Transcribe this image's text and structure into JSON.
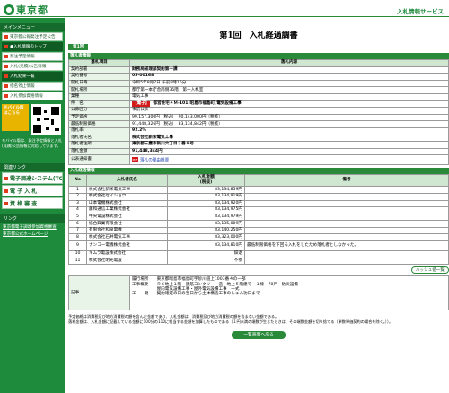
{
  "header": {
    "logo_text": "東京都",
    "service_name": "入札情報サービス"
  },
  "sidebar": {
    "menu_heading": "メインメニュー",
    "items": [
      {
        "label": "東京都公報発注予定公告"
      },
      {
        "label": "●入札情報のトップ"
      },
      {
        "label": "発注予定情報"
      },
      {
        "label": "入札(見積)公告情報"
      },
      {
        "label": "入札結果一覧"
      },
      {
        "label": "指名停止情報"
      },
      {
        "label": "入札参加資格情報"
      }
    ],
    "mobile_label": "モバイル版 はこちら",
    "mobile_note": "モバイル版は、発注予定情報と入札(見積)公告情報に対応しています。",
    "links_heading": "関連リンク",
    "big_items": [
      {
        "label": "電子調達システム(TOP)"
      },
      {
        "label": "電 子 入 札"
      },
      {
        "label": "資 格 審 査"
      }
    ],
    "links2_heading": "リンク",
    "links": [
      {
        "label": "東京都電子調達参加資格審査"
      },
      {
        "label": "東京都公式ホームページ"
      }
    ]
  },
  "main": {
    "page_title": "第1回　入札経過調書",
    "round_tag": "第1回",
    "section1_title": "落札者情報",
    "info_head": {
      "col1": "落札項目",
      "col2": "落札内容"
    },
    "info_rows": [
      {
        "label": "契約部署",
        "value": "財務局経理部契約第一課"
      },
      {
        "label": "契約番号",
        "value": "05-00168"
      },
      {
        "label": "開札日時",
        "value": "令和5年8月7日 午前9時15分"
      },
      {
        "label": "開札場所",
        "value": "都庁第一本庁舎南側35階　第一入札室"
      },
      {
        "label": "業種",
        "value": "電気工事"
      },
      {
        "label": "件　名",
        "tag": "【電子】",
        "value": "都営住宅４Ｍ-101(昭島市福島町)電気設備工事"
      },
      {
        "label": "公募区分",
        "value": "事前公表"
      },
      {
        "label": "予定価格",
        "value": "99,157,300円（税込）　90,143,000円（税抜）"
      },
      {
        "label": "最低制限価格",
        "value": "91,448,326円（税込）　83,134,842円（税抜）"
      },
      {
        "label": "落札率",
        "value": "92.2%"
      },
      {
        "label": "落札者氏名",
        "value": "株式会社新栄電気工事"
      },
      {
        "label": "落札者住所",
        "value": "東京都三鷹市新川六丁目２番８号"
      },
      {
        "label": "落札金額",
        "value": "91,448,344円"
      },
      {
        "label": "公表通知書",
        "link": "落札の理由概要",
        "pdf": "PDF"
      }
    ],
    "section2_title": "入札経過情報",
    "bid_head": {
      "no": "No",
      "name": "入札者氏名",
      "amount": "入札金額\n(税抜)",
      "note": "備考"
    },
    "bids": [
      {
        "no": "1",
        "name": "株式会社新栄電気工事",
        "amount": "83,134,859円",
        "note": ""
      },
      {
        "no": "2",
        "name": "株式会社セイショウ",
        "amount": "83,134,919円",
        "note": ""
      },
      {
        "no": "3",
        "name": "山本電機株式会社",
        "amount": "83,134,920円",
        "note": ""
      },
      {
        "no": "4",
        "name": "藤和通信工業株式会社",
        "amount": "83,134,975円",
        "note": ""
      },
      {
        "no": "5",
        "name": "中央電設株式会社",
        "amount": "83,134,979円",
        "note": ""
      },
      {
        "no": "6",
        "name": "協合興業有限会社",
        "amount": "83,135,009円",
        "note": ""
      },
      {
        "no": "7",
        "name": "有限会社和泉電機",
        "amount": "83,140,250円",
        "note": ""
      },
      {
        "no": "8",
        "name": "株式会社石井電気工事",
        "amount": "83,323,000円",
        "note": ""
      },
      {
        "no": "9",
        "name": "ナンコー電機株式会社",
        "amount": "83,134,810円",
        "note": "最低制限価格を下回る入札をしたため落札者としなかった。"
      },
      {
        "no": "10",
        "name": "キムラ電設株式会社",
        "amount": "辞退",
        "note": ""
      },
      {
        "no": "11",
        "name": "株式会社明光電設",
        "amount": "不参",
        "note": ""
      }
    ],
    "chart_button": "ハッシュ値一覧",
    "notes_label": "記事",
    "notes_text": "履行場所　　東京都昭島市福島町宇砂川道上1003番４の一部\n工事概要　　ＲＣ地上１階　鉄筋コンクリート造　地上５階建て　１棟　70戸　防災設備\n　　　　　　屋内電気設備工事・屋外電気設備工事　一式\n工　　期　　契約確定の日の翌日から主体構造工事のしゅん功日まで",
    "footnote": "予定価格は消費税及び地方消費税の額を含んだ金額であり、入札金額は、消費税及び地方消費税の額を含まない金額である。\n落札金額は、入札金額に記載している金額に100分の110に相当する金額を加算したものである（１円未満の端数が生じたときは、その端数金額を切り捨てる（単数単価契約の場合を除く。））。",
    "back_button": "一覧画面へ戻る"
  }
}
